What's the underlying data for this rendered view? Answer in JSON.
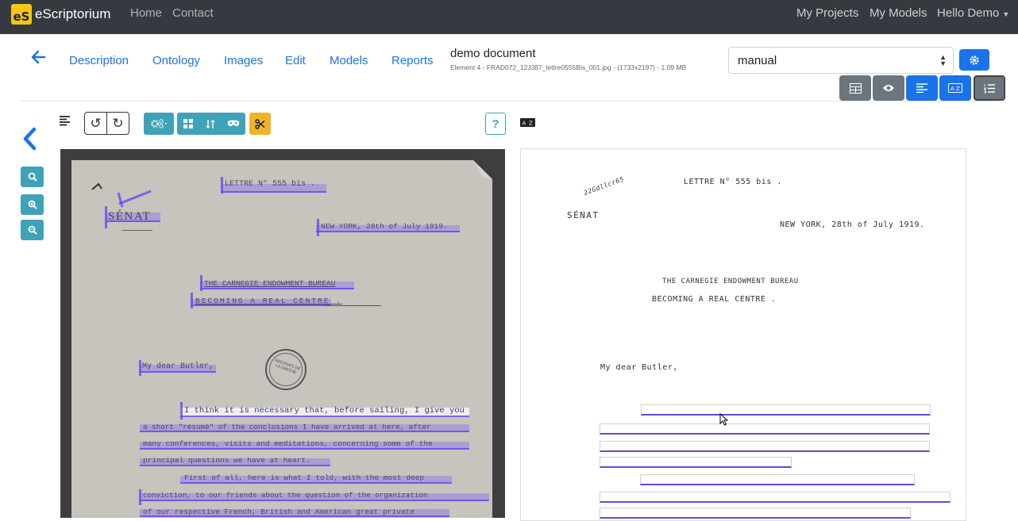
{
  "navbar": {
    "brand_logo": "eS",
    "brand_name": "eScriptorium",
    "home": "Home",
    "contact": "Contact",
    "my_projects": "My Projects",
    "my_models": "My Models",
    "hello": "Hello Demo"
  },
  "tabs": {
    "description": "Description",
    "ontology": "Ontology",
    "images": "Images",
    "edit": "Edit",
    "models": "Models",
    "reports": "Reports"
  },
  "document": {
    "title": "demo document",
    "subtitle": "Element 4 - FRAD072_12J387_lettre0555Bis_001.jpg - (1733x2197) - 1.09 MB"
  },
  "transcription_select": {
    "value": "manual"
  },
  "help_label": "?",
  "scan": {
    "lines": [
      "LETTRE N° 555 bis .",
      "SÉNAT",
      "NEW YORK, 28th of July 1919.",
      "THE CARNEGIE ENDOWMENT BUREAU",
      "BECOMING A REAL CENTRE .",
      "My dear Butler,",
      "I think it is necessary that, before sailing, I give you",
      "a short \"résumé\" of the conclusions I have arrived at here, after",
      "many conferences, visits and meditations, concerning some of the",
      "principal questions we have at heart.",
      "First of all, here is what I told, with the most deep",
      "conviction, to our friends about the question of the organization",
      "of our respective French, British and American great private"
    ],
    "stamp": "ARCHIVES DE LA SARTHE"
  },
  "transcription": {
    "lines": [
      "LETTRE N° 555 bis .",
      "SÉNAT",
      "NEW YORK, 28th of July 1919.",
      "THE CARNEGIE ENDOWMENT BUREAU",
      "BECOMING A REAL CENTRE .",
      "My dear Butler,"
    ],
    "rotated_text": "22Gdllcr65"
  },
  "colors": {
    "navbar": "#343a40",
    "link_blue": "#1a73e8",
    "teal": "#3fa2b8",
    "yellow": "#f0b429",
    "grey_btn": "#6c757d",
    "highlight": "#785aff"
  }
}
